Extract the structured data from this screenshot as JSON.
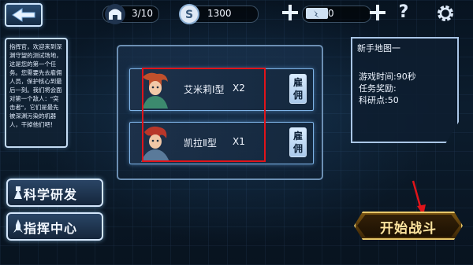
{
  "topbar": {
    "units_count": "3/10",
    "coins_value": "1300",
    "energy_value": "0",
    "help_symbol": "?"
  },
  "icons": {
    "back": "back-arrow-icon",
    "helmet": "helmet-icon",
    "coin": "coin-icon",
    "battery": "battery-icon",
    "plus": "plus-icon",
    "help": "question-icon",
    "gear": "gear-icon"
  },
  "intro_text": "指挥官，欢迎来到深渊守望的测试场地，这是您的第一个任务。您需要先去雇佣人员，保护核心到最后一刻。我们将会面对第一个敌人：\"突击者\"，它们是最先被深渊污染的机器人，干掉他们吧！",
  "hire_list": [
    {
      "name": "艾米莉Ⅰ型",
      "qty": "X2",
      "hire_label": "雇佣"
    },
    {
      "name": "凯拉Ⅱ型",
      "qty": "X1",
      "hire_label": "雇佣"
    }
  ],
  "map_info": {
    "title": "新手地图一",
    "game_time": "游戏时间:90秒",
    "reward_label": "任务奖励:",
    "research": "科研点:50"
  },
  "buttons": {
    "science": "科学研发",
    "command": "指挥中心",
    "start": "开始战斗"
  },
  "colors": {
    "highlight_box": "#e0141a",
    "start_text": "#ffe6a0",
    "start_border": "#e8c86a",
    "panel_border": "#c4dcf4"
  }
}
